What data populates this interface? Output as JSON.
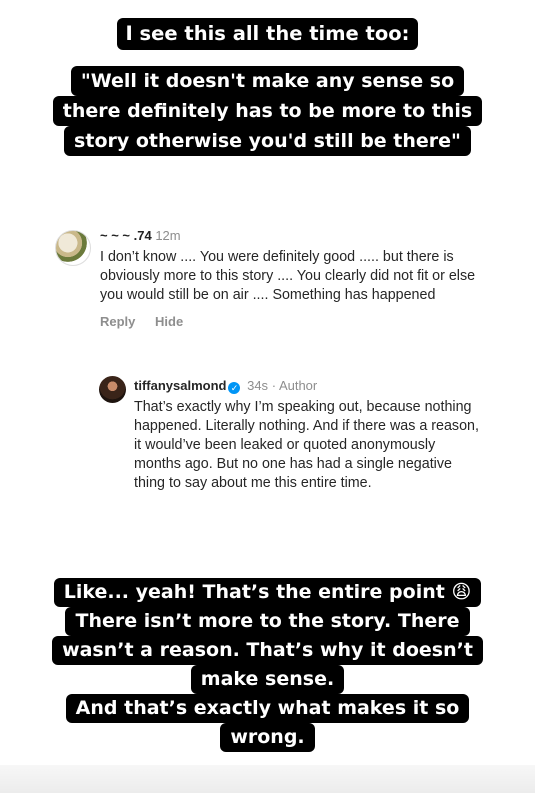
{
  "captions": {
    "top": [
      "I see this all the time too:"
    ],
    "quote": [
      "\"Well it doesn't make any sense so",
      "there definitely has to be more to this",
      "story otherwise you'd still be there\""
    ],
    "bottom": [
      "Like... yeah! That’s the entire point 😩",
      "There isn’t more to the story. There",
      "wasn’t a reason. That’s why it doesn’t",
      "make sense.",
      "And that’s exactly what makes it so",
      "wrong."
    ]
  },
  "comment_1": {
    "username": "~ ~ ~ .74",
    "time": "12m",
    "text": "I don’t know .... You were definitely good ..... but there is obviously more to this story .... You clearly did not fit or else you would still be on air .... Something has happened",
    "reply_label": "Reply",
    "hide_label": "Hide"
  },
  "comment_2": {
    "username": "tiffanysalmond",
    "verified_icon": "✓",
    "time": "34s",
    "role": "Author",
    "text": "That’s exactly why I’m speaking out, because nothing happened. Literally nothing. And if there was a reason, it would’ve been leaked or quoted anonymously months ago. But no one has had a single negative thing to say about me this entire time."
  }
}
